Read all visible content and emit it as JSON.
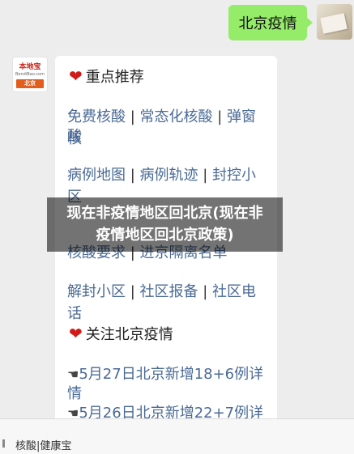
{
  "chat": {
    "user_message": "北京疫情",
    "bot_logo": {
      "name": "本地宝",
      "site": "BendiBao.com",
      "city": "北京"
    },
    "sections": [
      {
        "title": "重点推荐",
        "lines": [
          {
            "segments": [
              "免费核酸",
              "常态化核酸",
              "弹窗核"
            ]
          },
          {
            "segments": [
              "酸"
            ]
          },
          {
            "segments": [
              "病例地图",
              "病例轨迹",
              "封控小区"
            ]
          },
          {
            "segments": [
              "核酸要求",
              "进京隔离名单"
            ]
          },
          {
            "segments": [
              "解封小区",
              "社区报备",
              "社区电话"
            ]
          }
        ]
      },
      {
        "title": "关注北京疫情",
        "lines": [
          {
            "text": "5月27日北京新增18+6例详"
          },
          {
            "text": "情"
          },
          {
            "text": "5月26日北京新增22+7例详"
          }
        ]
      }
    ],
    "separator": " | ",
    "finger_glyph": "☚"
  },
  "overlay": {
    "line1": "现在非疫情地区回北京(现在非",
    "line2": "疫情地区回北京政策)"
  },
  "bottom_menu": {
    "label": "核酸|健康宝"
  },
  "colors": {
    "user_bubble": "#95ec69",
    "link": "#4a6a95",
    "heart": "#d01b1b",
    "background": "#ededed"
  }
}
